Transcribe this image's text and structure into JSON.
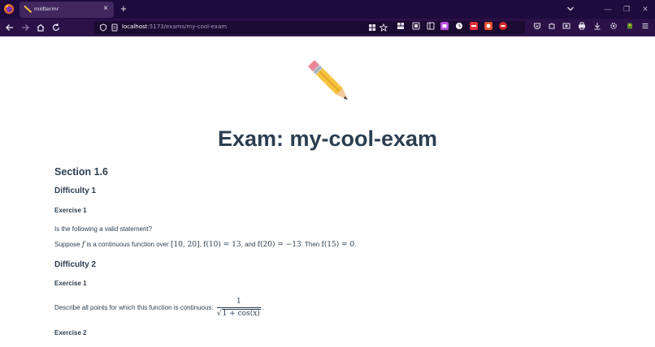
{
  "browser": {
    "tab_title": "midtermr",
    "tab_close": "×",
    "new_tab": "+",
    "url_host": "localhost",
    "url_path": ":5173/exams/my-cool-exam",
    "window_minimize": "—",
    "window_restore": "❐",
    "window_close": "✕",
    "colors": {
      "tabbar": "#1f0b3d",
      "navbar": "#2b1148",
      "tab_active": "#42275f"
    }
  },
  "page": {
    "title": "Exam: my-cool-exam",
    "section": "Section 1.6",
    "difficulty_1": "Difficulty 1",
    "d1_exercise_1": "Exercise 1",
    "d1_ex1_question": "Is the following a valid statement?",
    "d1_ex1_statement": {
      "suppose": "Suppose ",
      "f": "f",
      "is_cont": " is a continuous function over ",
      "interval": "[10, 20]",
      "comma1": ", ",
      "f10": "f(10) = 13",
      "and": ", and ",
      "f20": "f(20) = −13",
      "then": ". Then ",
      "f15": "f(15) = 0",
      "end": "."
    },
    "difficulty_2": "Difficulty 2",
    "d2_exercise_1": "Exercise 1",
    "d2_ex1_text": "Describe all points for which this function is continuous: ",
    "d2_ex1_frac_num": "1",
    "d2_ex1_frac_den_sqrt": "√",
    "d2_ex1_frac_den": "1 + cos(x)",
    "d2_ex1_end": ".",
    "d2_exercise_2": "Exercise 2",
    "colors": {
      "text": "#2c3e50",
      "background": "#ffffff"
    }
  }
}
